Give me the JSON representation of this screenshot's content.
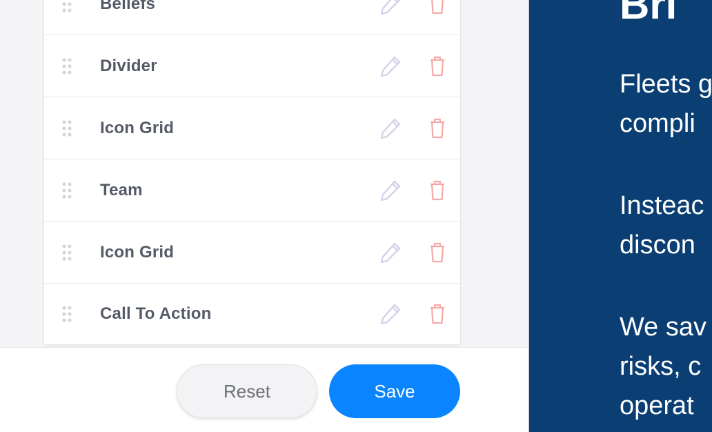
{
  "blocks": [
    {
      "label": "Beliefs"
    },
    {
      "label": "Divider"
    },
    {
      "label": "Icon Grid"
    },
    {
      "label": "Team"
    },
    {
      "label": "Icon Grid"
    },
    {
      "label": "Call To Action"
    }
  ],
  "footer": {
    "reset_label": "Reset",
    "save_label": "Save"
  },
  "preview": {
    "heading": "Bri",
    "paragraphs": [
      [
        "Fleets g",
        "compli"
      ],
      [
        "Insteac",
        "discon"
      ],
      [
        "We sav",
        "risks, c",
        "operat"
      ]
    ]
  },
  "colors": {
    "accent": "#0a84ff",
    "preview_background": "#0b3f73",
    "edit_icon": "#d6d0ea",
    "delete_icon": "#f4a9a9",
    "drag_handle": "#d4d6dd"
  },
  "icons": {
    "drag": "drag-handle-icon",
    "edit": "pencil-icon",
    "delete": "trash-icon"
  }
}
